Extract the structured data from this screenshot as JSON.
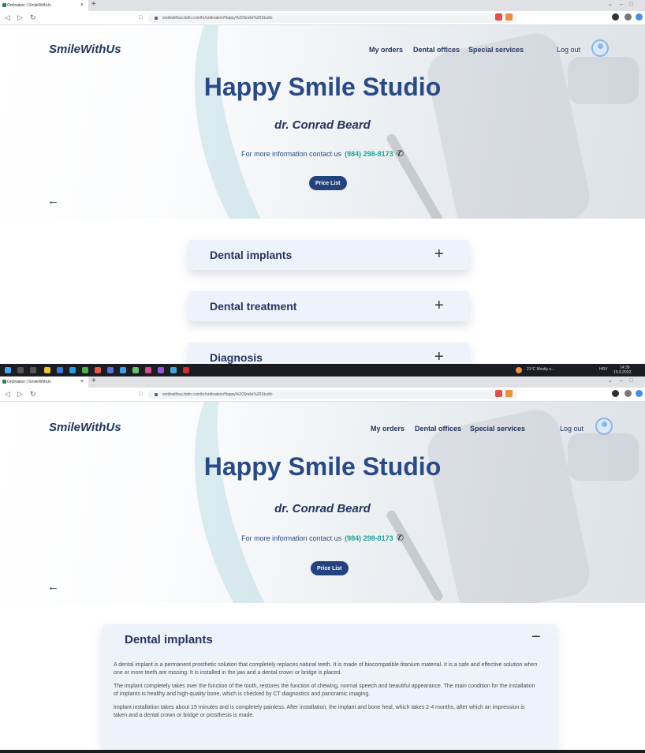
{
  "browser": {
    "tab_title": "Ordination | SmileWithUs",
    "new_tab": "+",
    "url": "smilewithus.bdm.com/hr/ordination/Happy%20Smile%20Studio"
  },
  "site": {
    "logo": "SmileWithUs",
    "nav": [
      "My orders",
      "Dental offices",
      "Special services"
    ],
    "logout": "Log out",
    "studio_name": "Happy Smile Studio",
    "doctor": "dr. Conrad Beard",
    "contact_text": "For more information contact us",
    "phone": "(984) 298-8173",
    "price_button": "Price List",
    "back_arrow": "←"
  },
  "accordion_collapsed": [
    {
      "title": "Dental implants",
      "sign": "+"
    },
    {
      "title": "Dental treatment",
      "sign": "+"
    },
    {
      "title": "Diagnosis",
      "sign": "+"
    }
  ],
  "accordion_expanded": {
    "title": "Dental implants",
    "sign": "−",
    "paragraphs": [
      "A dental implant is a permanent prosthetic solution that completely replaces natural teeth. It is made of biocompatible titanium material. It is a safe and effective solution when one or more teeth are missing. It is installed in the jaw and a dental crown or bridge is placed.",
      "The implant completely takes over the function of the tooth, restores the function of chewing, normal speech and beautiful appearance. The main condition for the installation of implants is healthy and high-quality bone, which is checked by CT diagnostics and panoramic imaging.",
      "Implant installation takes about 15 minutes and is completely painless. After installation, the implant and bone heal, which takes 2-4 months, after which an impression is taken and a dental crown or bridge or prosthesis is made."
    ]
  },
  "taskbar": {
    "weather": "21°C Mostly s...",
    "lang": "HRV",
    "time": "14:39",
    "date": "19.9.2022."
  },
  "colors": {
    "brand_navy": "#24365f",
    "title_blue": "#2a4a86",
    "phone_teal": "#1fa398",
    "button_blue": "#24437e",
    "accordion_bg": "#eef2fb"
  },
  "icons": [
    "back-arrow-icon",
    "reload-icon",
    "lock-icon",
    "user-avatar-icon",
    "phone-icon",
    "plus-icon",
    "minus-icon",
    "windows-start-icon"
  ]
}
